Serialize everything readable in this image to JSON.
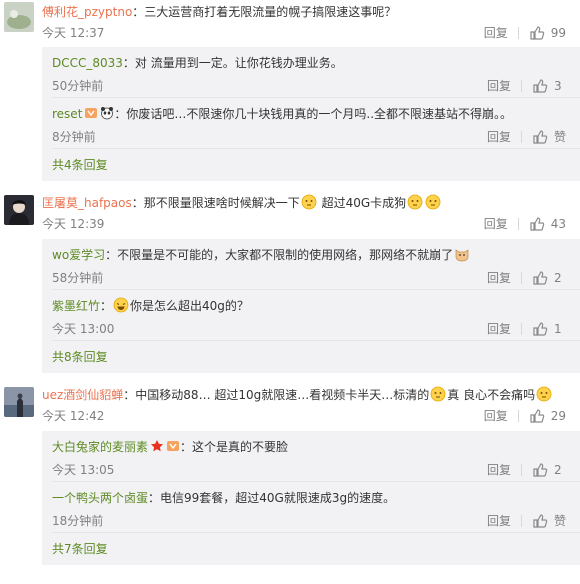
{
  "colors": {
    "username": "#eb7350",
    "reply_username": "#5d8a22",
    "meta": "#808080",
    "thread_bg": "#f2f2f5"
  },
  "comments": [
    {
      "user": "傅利花_pzyptno",
      "text": "：三大运营商打着无限流量的幌子搞限速这事呢？",
      "time": "今天 12:37",
      "reply_label": "回复",
      "likes": "99",
      "replies": [
        {
          "user": "DCCC_8033",
          "text": "：对  流量用到一定。让你花钱办理业务。",
          "time": "50分钟前",
          "reply_label": "回复",
          "likes": "3"
        },
        {
          "user": "reset",
          "text": "：你废话吧…不限速你几十块钱用真的一个月吗..全都不限速基站不得崩。。",
          "time": "8分钟前",
          "reply_label": "回复",
          "likes": "赞"
        }
      ],
      "more": "共4条回复"
    },
    {
      "user": "匡屠莫_hafpaos",
      "text_a": "：那不限量限速啥时候解决一下",
      "text_b": " 超过40G卡成狗",
      "time": "今天 12:39",
      "reply_label": "回复",
      "likes": "43",
      "replies": [
        {
          "user": "wo爱学习",
          "text": "：不限量是不可能的，大家都不限制的使用网络，那网络不就崩了",
          "time": "58分钟前",
          "reply_label": "回复",
          "likes": "2"
        },
        {
          "user": "紫墨红竹",
          "text": "你是怎么超出40g的？",
          "time": "今天 13:00",
          "reply_label": "回复",
          "likes": "1"
        }
      ],
      "more": "共8条回复"
    },
    {
      "user": "uez酒剑仙貂蝉",
      "text_a": "：中国移动88… 超过10g就限速…看视频卡半天…标清的",
      "text_b": "真   良心不会痛吗",
      "time": "今天 12:42",
      "reply_label": "回复",
      "likes": "29",
      "replies": [
        {
          "user": "大白兔家的麦丽素",
          "text": "：这个是真的不要脸",
          "time": "今天 13:05",
          "reply_label": "回复",
          "likes": "2"
        },
        {
          "user": "一个鸭头两个卤蛋",
          "text": "：电信99套餐，超过40G就限速成3g的速度。",
          "time": "18分钟前",
          "reply_label": "回复",
          "likes": "赞"
        }
      ],
      "more": "共7条回复"
    }
  ]
}
